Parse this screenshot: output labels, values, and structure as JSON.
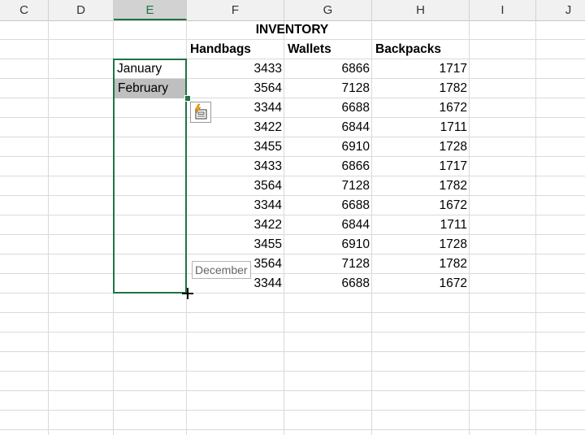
{
  "columns": [
    "C",
    "D",
    "E",
    "F",
    "G",
    "H",
    "I",
    "J"
  ],
  "selected_column": "E",
  "sheet": {
    "title": "INVENTORY",
    "headers": [
      "Handbags",
      "Wallets",
      "Backpacks"
    ],
    "months": [
      "January",
      "February"
    ],
    "rows": [
      [
        "3433",
        "6866",
        "1717"
      ],
      [
        "3564",
        "7128",
        "1782"
      ],
      [
        "3344",
        "6688",
        "1672"
      ],
      [
        "3422",
        "6844",
        "1711"
      ],
      [
        "3455",
        "6910",
        "1728"
      ],
      [
        "3433",
        "6866",
        "1717"
      ],
      [
        "3564",
        "7128",
        "1782"
      ],
      [
        "3344",
        "6688",
        "1672"
      ],
      [
        "3422",
        "6844",
        "1711"
      ],
      [
        "3455",
        "6910",
        "1728"
      ],
      [
        "3564",
        "7128",
        "1782"
      ],
      [
        "3344",
        "6688",
        "1672"
      ]
    ]
  },
  "autofill_tooltip": "December",
  "flash_fill_icon": "flash-fill-options-icon",
  "colors": {
    "selection": "#217346",
    "header_bg": "#f1f1f1"
  }
}
